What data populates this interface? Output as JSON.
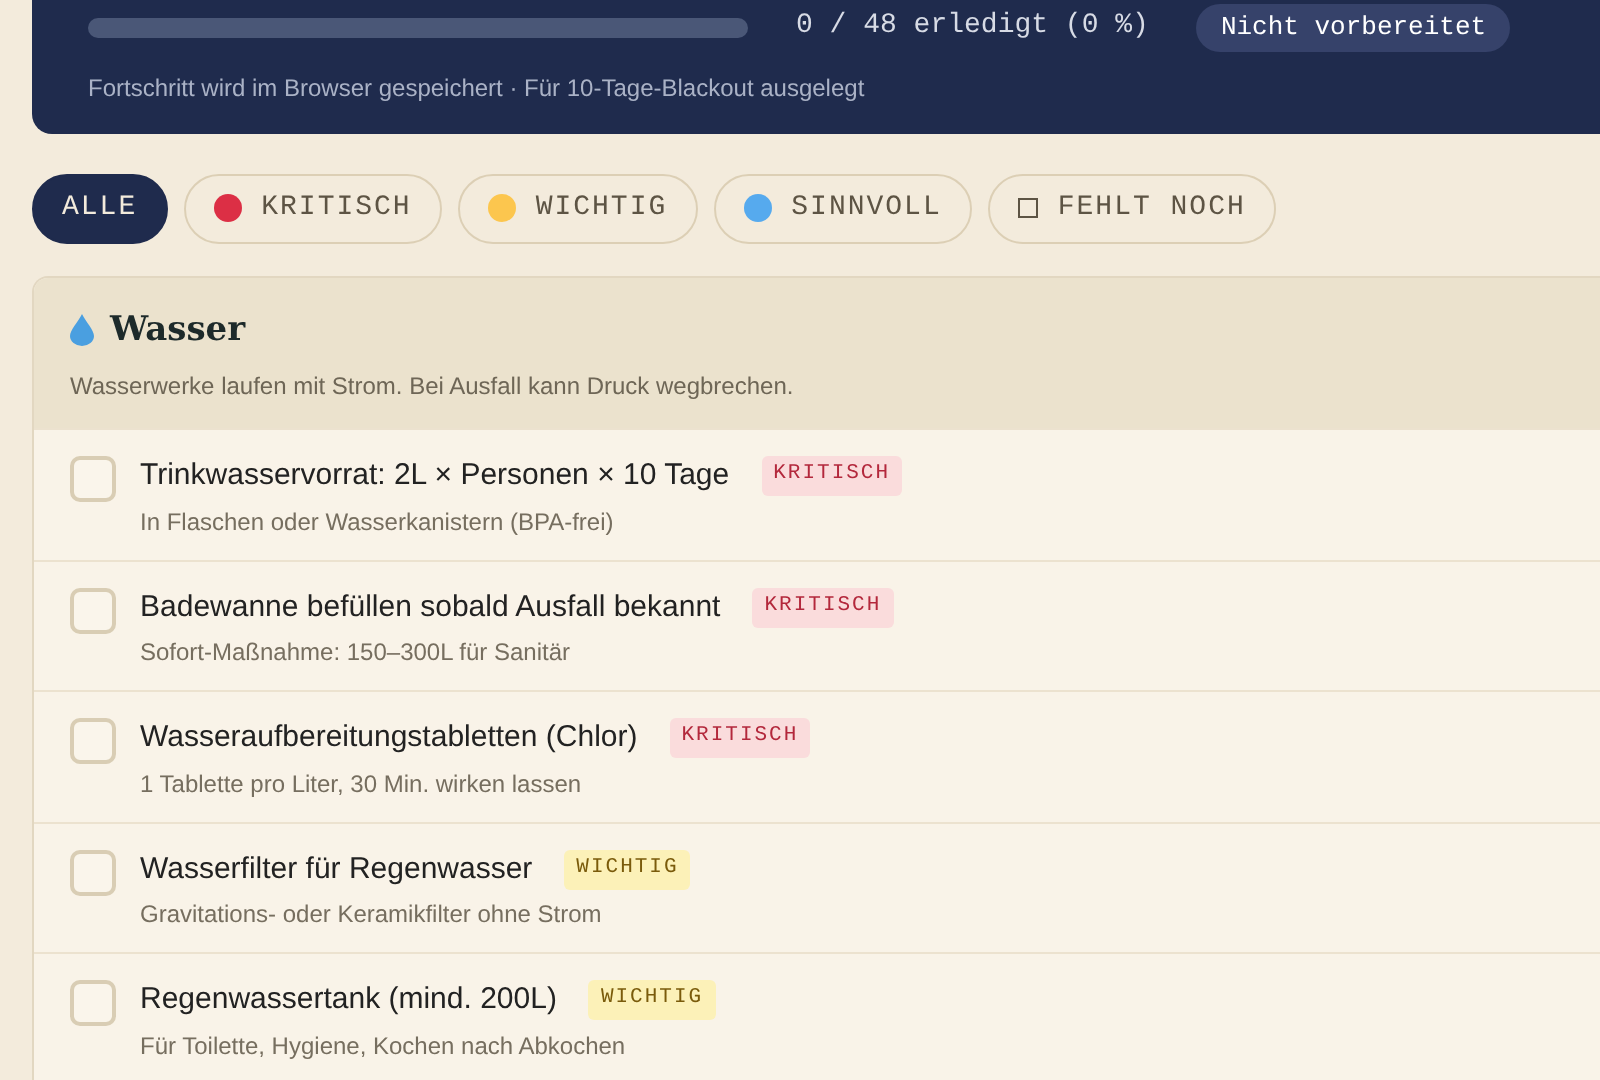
{
  "header": {
    "progress": {
      "level": 0
    },
    "progress_text": "0 / 48 erledigt (0 %)",
    "status_badge": "Nicht vorbereitet",
    "note": "Fortschritt wird im Browser gespeichert · Für 10-Tage-Blackout ausgelegt"
  },
  "filters": [
    {
      "label": "ALLE",
      "kind": "all",
      "selected": true
    },
    {
      "label": "KRITISCH",
      "kind": "priority",
      "color": "#dc2f45",
      "selected": false
    },
    {
      "label": "WICHTIG",
      "kind": "priority",
      "color": "#fcc64e",
      "selected": false
    },
    {
      "label": "SINNVOLL",
      "kind": "priority",
      "color": "#56aaee",
      "selected": false
    },
    {
      "label": "FEHLT NOCH",
      "kind": "missing",
      "selected": false
    }
  ],
  "section": {
    "title": "Wasser",
    "description": "Wasserwerke laufen mit Strom. Bei Ausfall kann Druck wegbrechen.",
    "items": [
      {
        "title": "Trinkwasservorrat: 2L × Personen × 10 Tage",
        "hint": "In Flaschen oder Wasserkanistern (BPA-frei)",
        "tag": "KRITISCH",
        "kind": "critical",
        "checked": false
      },
      {
        "title": "Badewanne befüllen sobald Ausfall bekannt",
        "hint": "Sofort-Maßnahme: 150–300L für Sanitär",
        "tag": "KRITISCH",
        "kind": "critical",
        "checked": false
      },
      {
        "title": "Wasseraufbereitungstabletten (Chlor)",
        "hint": "1 Tablette pro Liter, 30 Min. wirken lassen",
        "tag": "KRITISCH",
        "kind": "critical",
        "checked": false
      },
      {
        "title": "Wasserfilter für Regenwasser",
        "hint": "Gravitations- oder Keramikfilter ohne Strom",
        "tag": "WICHTIG",
        "kind": "important",
        "checked": false
      },
      {
        "title": "Regenwassertank (mind. 200L)",
        "hint": "Für Toilette, Hygiene, Kochen nach Abkochen",
        "tag": "WICHTIG",
        "kind": "important",
        "checked": false
      }
    ]
  }
}
